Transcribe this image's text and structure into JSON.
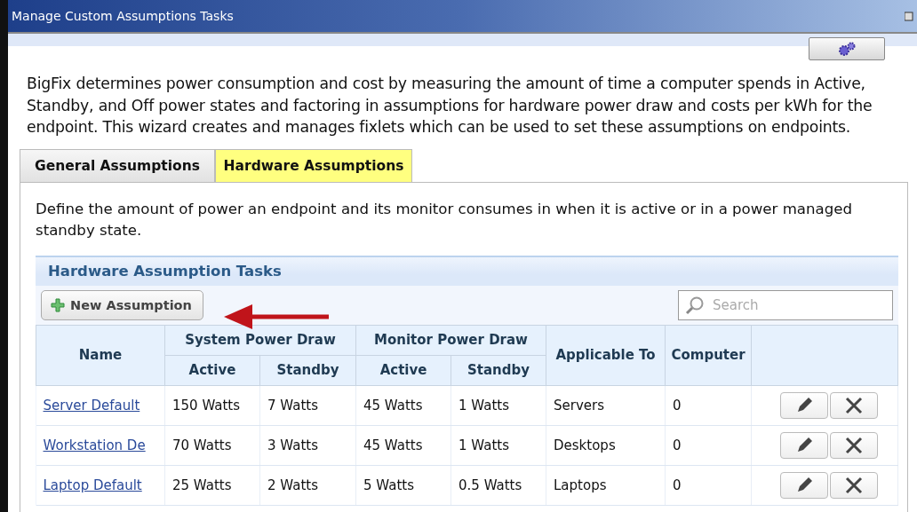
{
  "window": {
    "title": "Manage Custom Assumptions Tasks"
  },
  "intro": "BigFix determines power consumption and cost by measuring the amount of time a computer spends in Active, Standby, and Off power states and factoring in assumptions for hardware power draw and costs per kWh for the endpoint. This wizard creates and manages fixlets which can be used to set these assumptions on endpoints.",
  "tabs": [
    {
      "label": "General Assumptions",
      "selected": false
    },
    {
      "label": "Hardware Assumptions",
      "selected": true
    }
  ],
  "description": "Define the amount of power an endpoint and its monitor consumes in when it is active or in a power managed standby state.",
  "section": {
    "title": "Hardware Assumption Tasks",
    "new_button": "New Assumption",
    "search": {
      "placeholder": "Search"
    }
  },
  "table": {
    "name_header": "Name",
    "groups": [
      {
        "label": "System Power Draw",
        "columns": [
          "Active",
          "Standby"
        ]
      },
      {
        "label": "Monitor Power Draw",
        "columns": [
          "Active",
          "Standby"
        ]
      }
    ],
    "other_headers": [
      "Applicable To",
      "Computer"
    ],
    "rows": [
      {
        "name": "Server Default",
        "cells": [
          "150 Watts",
          "7 Watts",
          "45 Watts",
          "1 Watts",
          "Servers",
          "0"
        ]
      },
      {
        "name": "Workstation De",
        "cells": [
          "70 Watts",
          "3 Watts",
          "45 Watts",
          "1 Watts",
          "Desktops",
          "0"
        ]
      },
      {
        "name": "Laptop Default",
        "cells": [
          "25 Watts",
          "2 Watts",
          "5 Watts",
          "0.5 Watts",
          "Laptops",
          "0"
        ]
      }
    ]
  }
}
